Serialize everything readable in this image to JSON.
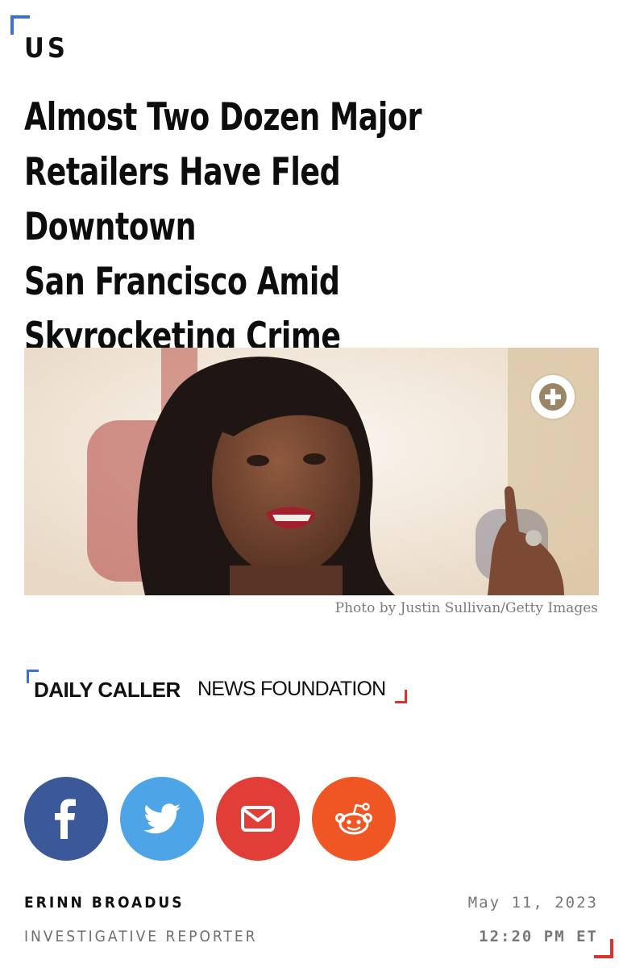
{
  "article": {
    "section": "US",
    "headline_lines": [
      "Almost Two Dozen Major",
      "Retailers Have Fled Downtown",
      "San Francisco Amid",
      "Skyrocketing Crime"
    ],
    "photo_caption": "Photo by Justin Sullivan/Getty Images"
  },
  "brand": {
    "name_bold": "DAILY CALLER",
    "name_light": "NEWS FOUNDATION"
  },
  "share": {
    "facebook_icon": "facebook-icon",
    "twitter_icon": "twitter-icon",
    "email_icon": "email-icon",
    "reddit_icon": "reddit-icon"
  },
  "byline": {
    "author": "ERINN BROADUS",
    "role": "INVESTIGATIVE REPORTER",
    "date": "May 11, 2023",
    "time": "12:20 PM ET"
  },
  "colors": {
    "accent_blue": "#3d6fd6",
    "accent_red": "#e0322c",
    "facebook": "#3b5998",
    "twitter": "#4da5e8",
    "email": "#e23e38",
    "reddit": "#ef5624"
  }
}
